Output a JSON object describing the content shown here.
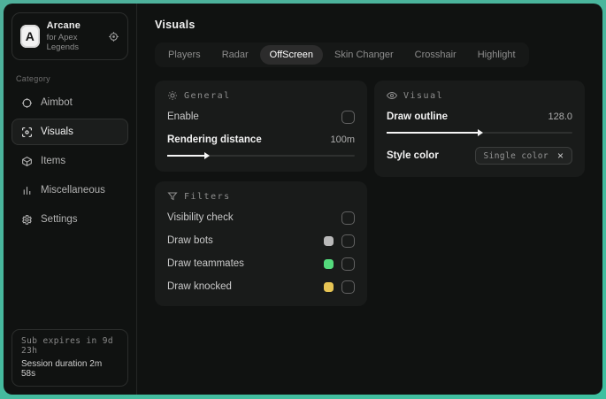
{
  "colors": {
    "frame_teal": "#4bb19c",
    "active_tab_bg": "#2c2c2c",
    "panel_bg": "#191b1a",
    "swatch_gray": "#b9b9b9",
    "swatch_green": "#54da7c",
    "swatch_yellow": "#e6c454"
  },
  "sidebar": {
    "logo_letter": "A",
    "app_title": "Arcane",
    "app_subtitle": "for Apex Legends",
    "category_label": "Category",
    "items": [
      {
        "label": "Aimbot"
      },
      {
        "label": "Visuals"
      },
      {
        "label": "Items"
      },
      {
        "label": "Miscellaneous"
      },
      {
        "label": "Settings"
      }
    ],
    "footer": {
      "sub_expires": "Sub expires in 9d 23h",
      "session_duration": "Session duration 2m 58s"
    }
  },
  "header": {
    "title": "Visuals"
  },
  "tabs": [
    {
      "label": "Players"
    },
    {
      "label": "Radar"
    },
    {
      "label": "OffScreen"
    },
    {
      "label": "Skin Changer"
    },
    {
      "label": "Crosshair"
    },
    {
      "label": "Highlight"
    }
  ],
  "active_tab": "OffScreen",
  "panels": {
    "general": {
      "title": "General",
      "enable_label": "Enable",
      "enable_checked": false,
      "rendering_label": "Rendering distance",
      "rendering_value": "100m",
      "rendering_percent": 20
    },
    "visual": {
      "title": "Visual",
      "outline_label": "Draw outline",
      "outline_value": "128.0",
      "outline_percent": 49,
      "style_label": "Style color",
      "style_value": "Single color",
      "style_clear_icon": "×"
    },
    "filters": {
      "title": "Filters",
      "rows": [
        {
          "label": "Visibility check",
          "swatch": null,
          "checked": false
        },
        {
          "label": "Draw bots",
          "swatch": "#b9b9b9",
          "checked": false
        },
        {
          "label": "Draw teammates",
          "swatch": "#54da7c",
          "checked": false
        },
        {
          "label": "Draw knocked",
          "swatch": "#e6c454",
          "checked": false
        }
      ]
    }
  }
}
